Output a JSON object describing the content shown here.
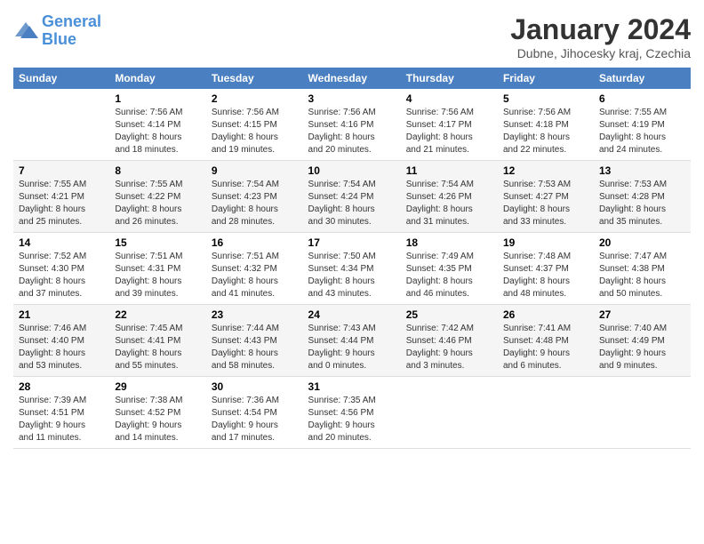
{
  "header": {
    "logo_line1": "General",
    "logo_line2": "Blue",
    "month_title": "January 2024",
    "subtitle": "Dubne, Jihocesky kraj, Czechia"
  },
  "weekdays": [
    "Sunday",
    "Monday",
    "Tuesday",
    "Wednesday",
    "Thursday",
    "Friday",
    "Saturday"
  ],
  "weeks": [
    [
      {
        "day": "",
        "info": ""
      },
      {
        "day": "1",
        "info": "Sunrise: 7:56 AM\nSunset: 4:14 PM\nDaylight: 8 hours\nand 18 minutes."
      },
      {
        "day": "2",
        "info": "Sunrise: 7:56 AM\nSunset: 4:15 PM\nDaylight: 8 hours\nand 19 minutes."
      },
      {
        "day": "3",
        "info": "Sunrise: 7:56 AM\nSunset: 4:16 PM\nDaylight: 8 hours\nand 20 minutes."
      },
      {
        "day": "4",
        "info": "Sunrise: 7:56 AM\nSunset: 4:17 PM\nDaylight: 8 hours\nand 21 minutes."
      },
      {
        "day": "5",
        "info": "Sunrise: 7:56 AM\nSunset: 4:18 PM\nDaylight: 8 hours\nand 22 minutes."
      },
      {
        "day": "6",
        "info": "Sunrise: 7:55 AM\nSunset: 4:19 PM\nDaylight: 8 hours\nand 24 minutes."
      }
    ],
    [
      {
        "day": "7",
        "info": "Sunrise: 7:55 AM\nSunset: 4:21 PM\nDaylight: 8 hours\nand 25 minutes."
      },
      {
        "day": "8",
        "info": "Sunrise: 7:55 AM\nSunset: 4:22 PM\nDaylight: 8 hours\nand 26 minutes."
      },
      {
        "day": "9",
        "info": "Sunrise: 7:54 AM\nSunset: 4:23 PM\nDaylight: 8 hours\nand 28 minutes."
      },
      {
        "day": "10",
        "info": "Sunrise: 7:54 AM\nSunset: 4:24 PM\nDaylight: 8 hours\nand 30 minutes."
      },
      {
        "day": "11",
        "info": "Sunrise: 7:54 AM\nSunset: 4:26 PM\nDaylight: 8 hours\nand 31 minutes."
      },
      {
        "day": "12",
        "info": "Sunrise: 7:53 AM\nSunset: 4:27 PM\nDaylight: 8 hours\nand 33 minutes."
      },
      {
        "day": "13",
        "info": "Sunrise: 7:53 AM\nSunset: 4:28 PM\nDaylight: 8 hours\nand 35 minutes."
      }
    ],
    [
      {
        "day": "14",
        "info": "Sunrise: 7:52 AM\nSunset: 4:30 PM\nDaylight: 8 hours\nand 37 minutes."
      },
      {
        "day": "15",
        "info": "Sunrise: 7:51 AM\nSunset: 4:31 PM\nDaylight: 8 hours\nand 39 minutes."
      },
      {
        "day": "16",
        "info": "Sunrise: 7:51 AM\nSunset: 4:32 PM\nDaylight: 8 hours\nand 41 minutes."
      },
      {
        "day": "17",
        "info": "Sunrise: 7:50 AM\nSunset: 4:34 PM\nDaylight: 8 hours\nand 43 minutes."
      },
      {
        "day": "18",
        "info": "Sunrise: 7:49 AM\nSunset: 4:35 PM\nDaylight: 8 hours\nand 46 minutes."
      },
      {
        "day": "19",
        "info": "Sunrise: 7:48 AM\nSunset: 4:37 PM\nDaylight: 8 hours\nand 48 minutes."
      },
      {
        "day": "20",
        "info": "Sunrise: 7:47 AM\nSunset: 4:38 PM\nDaylight: 8 hours\nand 50 minutes."
      }
    ],
    [
      {
        "day": "21",
        "info": "Sunrise: 7:46 AM\nSunset: 4:40 PM\nDaylight: 8 hours\nand 53 minutes."
      },
      {
        "day": "22",
        "info": "Sunrise: 7:45 AM\nSunset: 4:41 PM\nDaylight: 8 hours\nand 55 minutes."
      },
      {
        "day": "23",
        "info": "Sunrise: 7:44 AM\nSunset: 4:43 PM\nDaylight: 8 hours\nand 58 minutes."
      },
      {
        "day": "24",
        "info": "Sunrise: 7:43 AM\nSunset: 4:44 PM\nDaylight: 9 hours\nand 0 minutes."
      },
      {
        "day": "25",
        "info": "Sunrise: 7:42 AM\nSunset: 4:46 PM\nDaylight: 9 hours\nand 3 minutes."
      },
      {
        "day": "26",
        "info": "Sunrise: 7:41 AM\nSunset: 4:48 PM\nDaylight: 9 hours\nand 6 minutes."
      },
      {
        "day": "27",
        "info": "Sunrise: 7:40 AM\nSunset: 4:49 PM\nDaylight: 9 hours\nand 9 minutes."
      }
    ],
    [
      {
        "day": "28",
        "info": "Sunrise: 7:39 AM\nSunset: 4:51 PM\nDaylight: 9 hours\nand 11 minutes."
      },
      {
        "day": "29",
        "info": "Sunrise: 7:38 AM\nSunset: 4:52 PM\nDaylight: 9 hours\nand 14 minutes."
      },
      {
        "day": "30",
        "info": "Sunrise: 7:36 AM\nSunset: 4:54 PM\nDaylight: 9 hours\nand 17 minutes."
      },
      {
        "day": "31",
        "info": "Sunrise: 7:35 AM\nSunset: 4:56 PM\nDaylight: 9 hours\nand 20 minutes."
      },
      {
        "day": "",
        "info": ""
      },
      {
        "day": "",
        "info": ""
      },
      {
        "day": "",
        "info": ""
      }
    ]
  ]
}
